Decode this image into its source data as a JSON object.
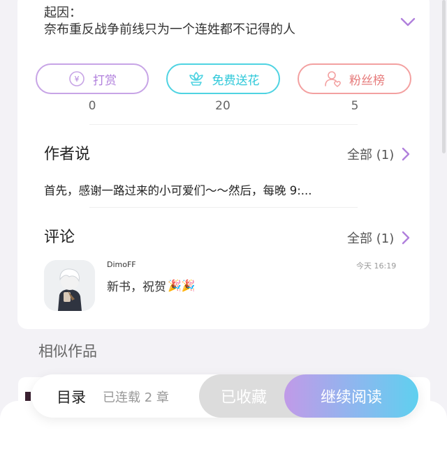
{
  "origin": {
    "label": "起因：",
    "text": "奈布重反战争前线只为一个连姓都不记得的人"
  },
  "actions": [
    {
      "label": "打赏",
      "count": "0",
      "icon": "yen-icon",
      "color": "#b07fdc"
    },
    {
      "label": "免费送花",
      "count": "20",
      "icon": "flower-icon",
      "color": "#2ec8d9"
    },
    {
      "label": "粉丝榜",
      "count": "5",
      "icon": "fan-user-icon",
      "color": "#e67a7a"
    }
  ],
  "author_note": {
    "title": "作者说",
    "all_label": "全部 (1)",
    "text": "首先，感谢一路过来的小可爱们～～然后，每晚 9:..."
  },
  "comments": {
    "title": "评论",
    "all_label": "全部 (1)",
    "items": [
      {
        "user": "DimoFF",
        "time": "今天 16:19",
        "text": "新书，祝贺",
        "emoji": "🎉🎉"
      }
    ]
  },
  "similar": {
    "title": "相似作品"
  },
  "bottom_bar": {
    "toc_label": "目录",
    "serial_label": "已连载 2 章",
    "collected_label": "已收藏",
    "continue_label": "继续阅读"
  },
  "colors": {
    "accent_purple": "#b07fdc",
    "accent_cyan": "#2ec8d9",
    "accent_red": "#e67a7a"
  }
}
